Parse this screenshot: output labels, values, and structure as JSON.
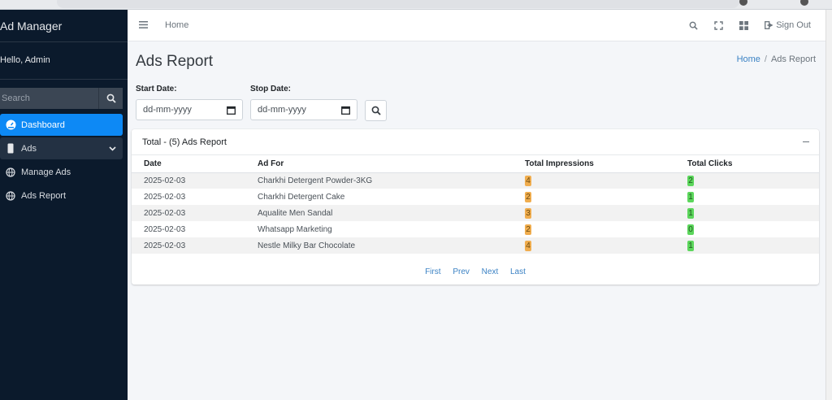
{
  "sidebar": {
    "brand": "Ad Manager",
    "greeting": "Hello, Admin",
    "search_placeholder": "Search",
    "items": [
      {
        "label": "Dashboard"
      },
      {
        "label": "Ads"
      },
      {
        "label": "Manage Ads"
      },
      {
        "label": "Ads Report"
      }
    ]
  },
  "topbar": {
    "home": "Home",
    "signout": "Sign Out"
  },
  "page": {
    "title": "Ads Report",
    "breadcrumb_home": "Home",
    "breadcrumb_sep": "/",
    "breadcrumb_current": "Ads Report"
  },
  "filter": {
    "start_label": "Start Date:",
    "stop_label": "Stop Date:",
    "start_value": "dd-mm-yyyy",
    "stop_value": "dd-mm-yyyy"
  },
  "report": {
    "heading": "Total - (5) Ads Report",
    "columns": [
      "Date",
      "Ad For",
      "Total Impressions",
      "Total Clicks"
    ],
    "rows": [
      {
        "date": "2025-02-03",
        "ad": "Charkhi Detergent Powder-3KG",
        "impressions": "4",
        "clicks": "2"
      },
      {
        "date": "2025-02-03",
        "ad": "Charkhi Detergent Cake",
        "impressions": "2",
        "clicks": "1"
      },
      {
        "date": "2025-02-03",
        "ad": "Aqualite Men Sandal",
        "impressions": "3",
        "clicks": "1"
      },
      {
        "date": "2025-02-03",
        "ad": "Whatsapp Marketing",
        "impressions": "2",
        "clicks": "0"
      },
      {
        "date": "2025-02-03",
        "ad": "Nestle Milky Bar Chocolate",
        "impressions": "4",
        "clicks": "1"
      }
    ]
  },
  "pager": {
    "first": "First",
    "prev": "Prev",
    "next": "Next",
    "last": "Last"
  },
  "colors": {
    "sidebar_bg": "#0b1a2c",
    "active_item": "#0d89f5",
    "impressions_badge": "#f0ad4e",
    "clicks_badge": "#5cd65c",
    "link": "#3b82c4"
  }
}
